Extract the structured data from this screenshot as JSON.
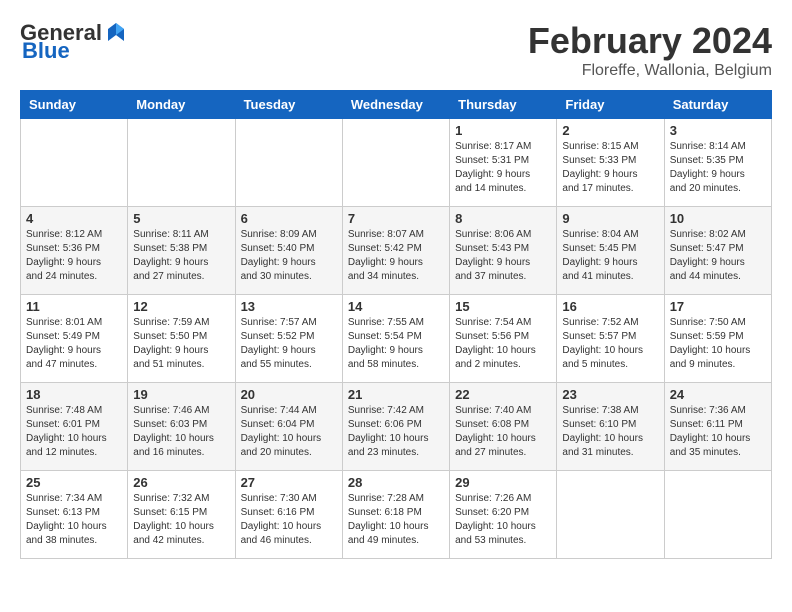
{
  "logo": {
    "general": "General",
    "blue": "Blue"
  },
  "title": {
    "month": "February 2024",
    "location": "Floreffe, Wallonia, Belgium"
  },
  "headers": [
    "Sunday",
    "Monday",
    "Tuesday",
    "Wednesday",
    "Thursday",
    "Friday",
    "Saturday"
  ],
  "weeks": [
    [
      {
        "day": "",
        "info": ""
      },
      {
        "day": "",
        "info": ""
      },
      {
        "day": "",
        "info": ""
      },
      {
        "day": "",
        "info": ""
      },
      {
        "day": "1",
        "info": "Sunrise: 8:17 AM\nSunset: 5:31 PM\nDaylight: 9 hours\nand 14 minutes."
      },
      {
        "day": "2",
        "info": "Sunrise: 8:15 AM\nSunset: 5:33 PM\nDaylight: 9 hours\nand 17 minutes."
      },
      {
        "day": "3",
        "info": "Sunrise: 8:14 AM\nSunset: 5:35 PM\nDaylight: 9 hours\nand 20 minutes."
      }
    ],
    [
      {
        "day": "4",
        "info": "Sunrise: 8:12 AM\nSunset: 5:36 PM\nDaylight: 9 hours\nand 24 minutes."
      },
      {
        "day": "5",
        "info": "Sunrise: 8:11 AM\nSunset: 5:38 PM\nDaylight: 9 hours\nand 27 minutes."
      },
      {
        "day": "6",
        "info": "Sunrise: 8:09 AM\nSunset: 5:40 PM\nDaylight: 9 hours\nand 30 minutes."
      },
      {
        "day": "7",
        "info": "Sunrise: 8:07 AM\nSunset: 5:42 PM\nDaylight: 9 hours\nand 34 minutes."
      },
      {
        "day": "8",
        "info": "Sunrise: 8:06 AM\nSunset: 5:43 PM\nDaylight: 9 hours\nand 37 minutes."
      },
      {
        "day": "9",
        "info": "Sunrise: 8:04 AM\nSunset: 5:45 PM\nDaylight: 9 hours\nand 41 minutes."
      },
      {
        "day": "10",
        "info": "Sunrise: 8:02 AM\nSunset: 5:47 PM\nDaylight: 9 hours\nand 44 minutes."
      }
    ],
    [
      {
        "day": "11",
        "info": "Sunrise: 8:01 AM\nSunset: 5:49 PM\nDaylight: 9 hours\nand 47 minutes."
      },
      {
        "day": "12",
        "info": "Sunrise: 7:59 AM\nSunset: 5:50 PM\nDaylight: 9 hours\nand 51 minutes."
      },
      {
        "day": "13",
        "info": "Sunrise: 7:57 AM\nSunset: 5:52 PM\nDaylight: 9 hours\nand 55 minutes."
      },
      {
        "day": "14",
        "info": "Sunrise: 7:55 AM\nSunset: 5:54 PM\nDaylight: 9 hours\nand 58 minutes."
      },
      {
        "day": "15",
        "info": "Sunrise: 7:54 AM\nSunset: 5:56 PM\nDaylight: 10 hours\nand 2 minutes."
      },
      {
        "day": "16",
        "info": "Sunrise: 7:52 AM\nSunset: 5:57 PM\nDaylight: 10 hours\nand 5 minutes."
      },
      {
        "day": "17",
        "info": "Sunrise: 7:50 AM\nSunset: 5:59 PM\nDaylight: 10 hours\nand 9 minutes."
      }
    ],
    [
      {
        "day": "18",
        "info": "Sunrise: 7:48 AM\nSunset: 6:01 PM\nDaylight: 10 hours\nand 12 minutes."
      },
      {
        "day": "19",
        "info": "Sunrise: 7:46 AM\nSunset: 6:03 PM\nDaylight: 10 hours\nand 16 minutes."
      },
      {
        "day": "20",
        "info": "Sunrise: 7:44 AM\nSunset: 6:04 PM\nDaylight: 10 hours\nand 20 minutes."
      },
      {
        "day": "21",
        "info": "Sunrise: 7:42 AM\nSunset: 6:06 PM\nDaylight: 10 hours\nand 23 minutes."
      },
      {
        "day": "22",
        "info": "Sunrise: 7:40 AM\nSunset: 6:08 PM\nDaylight: 10 hours\nand 27 minutes."
      },
      {
        "day": "23",
        "info": "Sunrise: 7:38 AM\nSunset: 6:10 PM\nDaylight: 10 hours\nand 31 minutes."
      },
      {
        "day": "24",
        "info": "Sunrise: 7:36 AM\nSunset: 6:11 PM\nDaylight: 10 hours\nand 35 minutes."
      }
    ],
    [
      {
        "day": "25",
        "info": "Sunrise: 7:34 AM\nSunset: 6:13 PM\nDaylight: 10 hours\nand 38 minutes."
      },
      {
        "day": "26",
        "info": "Sunrise: 7:32 AM\nSunset: 6:15 PM\nDaylight: 10 hours\nand 42 minutes."
      },
      {
        "day": "27",
        "info": "Sunrise: 7:30 AM\nSunset: 6:16 PM\nDaylight: 10 hours\nand 46 minutes."
      },
      {
        "day": "28",
        "info": "Sunrise: 7:28 AM\nSunset: 6:18 PM\nDaylight: 10 hours\nand 49 minutes."
      },
      {
        "day": "29",
        "info": "Sunrise: 7:26 AM\nSunset: 6:20 PM\nDaylight: 10 hours\nand 53 minutes."
      },
      {
        "day": "",
        "info": ""
      },
      {
        "day": "",
        "info": ""
      }
    ]
  ]
}
